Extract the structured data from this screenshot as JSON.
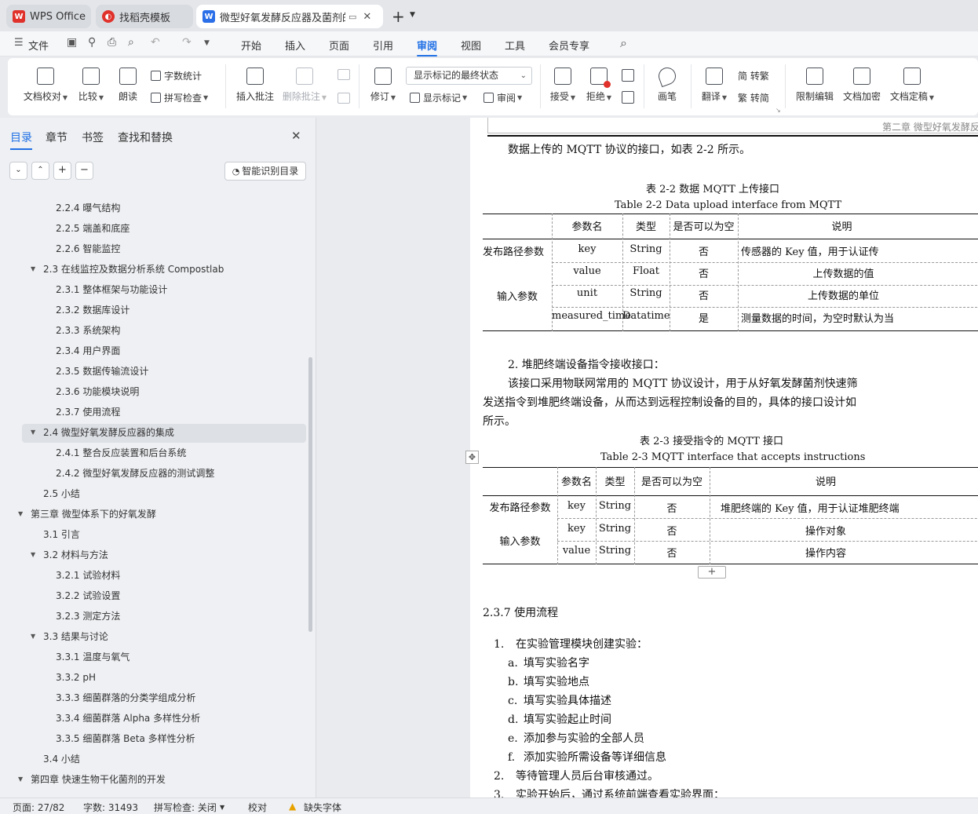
{
  "tabs": [
    {
      "label": "WPS Office"
    },
    {
      "label": "找稻壳模板"
    },
    {
      "label": "微型好氧发酵反应器及菌剂的"
    }
  ],
  "menu": {
    "file": "文件",
    "items": [
      "开始",
      "插入",
      "页面",
      "引用",
      "审阅",
      "视图",
      "工具",
      "会员专享"
    ],
    "active": "审阅"
  },
  "ribbon": {
    "doc_proof": "文档校对",
    "compare": "比较",
    "read_aloud": "朗读",
    "word_count": "字数统计",
    "spell_check": "拼写检查",
    "insert_comment": "插入批注",
    "delete_comment": "删除批注",
    "revise": "修订",
    "markup_state": "显示标记的最终状态",
    "show_markup": "显示标记",
    "review": "审阅",
    "accept": "接受",
    "reject": "拒绝",
    "ink": "画笔",
    "translate": "翻译",
    "to_traditional": "简 转繁",
    "to_simplified": "繁 转简",
    "restrict": "限制编辑",
    "encrypt": "文档加密",
    "finalize": "文档定稿"
  },
  "sidebar": {
    "tabs": [
      "目录",
      "章节",
      "书签",
      "查找和替换"
    ],
    "smart_button": "智能识别目录",
    "toc": [
      {
        "text": "2.2.4 曝气结构",
        "level": 3
      },
      {
        "text": "2.2.5 端盖和底座",
        "level": 3
      },
      {
        "text": "2.2.6 智能监控",
        "level": 3
      },
      {
        "text": "2.3 在线监控及数据分析系统 Compostlab",
        "level": 2,
        "expanded": true
      },
      {
        "text": "2.3.1 整体框架与功能设计",
        "level": 3
      },
      {
        "text": "2.3.2 数据库设计",
        "level": 3
      },
      {
        "text": "2.3.3 系统架构",
        "level": 3
      },
      {
        "text": "2.3.4 用户界面",
        "level": 3
      },
      {
        "text": "2.3.5 数据传输流设计",
        "level": 3
      },
      {
        "text": "2.3.6 功能模块说明",
        "level": 3
      },
      {
        "text": "2.3.7 使用流程",
        "level": 3
      },
      {
        "text": "2.4 微型好氧发酵反应器的集成",
        "level": 2,
        "expanded": true,
        "selected": true
      },
      {
        "text": "2.4.1 整合反应装置和后台系统",
        "level": 3
      },
      {
        "text": "2.4.2 微型好氧发酵反应器的测试调整",
        "level": 3
      },
      {
        "text": "2.5 小结",
        "level": 2
      },
      {
        "text": "第三章  微型体系下的好氧发酵",
        "level": 1,
        "expanded": true
      },
      {
        "text": "3.1 引言",
        "level": 2
      },
      {
        "text": "3.2 材料与方法",
        "level": 2,
        "expanded": true
      },
      {
        "text": "3.2.1 试验材料",
        "level": 3
      },
      {
        "text": "3.2.2 试验设置",
        "level": 3
      },
      {
        "text": "3.2.3 测定方法",
        "level": 3
      },
      {
        "text": "3.3 结果与讨论",
        "level": 2,
        "expanded": true
      },
      {
        "text": "3.3.1 温度与氧气",
        "level": 3
      },
      {
        "text": "3.3.2 pH",
        "level": 3
      },
      {
        "text": "3.3.3 细菌群落的分类学组成分析",
        "level": 3
      },
      {
        "text": "3.3.4 细菌群落 Alpha 多样性分析",
        "level": 3
      },
      {
        "text": "3.3.5 细菌群落 Beta 多样性分析",
        "level": 3
      },
      {
        "text": "3.4 小结",
        "level": 2
      },
      {
        "text": "第四章  快速生物干化菌剂的开发",
        "level": 1,
        "expanded": true
      }
    ]
  },
  "doc": {
    "header_text": "第二章  微型好氧发酵反",
    "para_intro": "数据上传的 MQTT 协议的接口，如表 2-2 所示。",
    "table1": {
      "caption_cn": "表 2-2 数据 MQTT 上传接口",
      "caption_en": "Table 2-2 Data upload interface from MQTT",
      "headers": [
        "参数名",
        "类型",
        "是否可以为空",
        "说明"
      ],
      "group1": "发布路径参数",
      "group2": "输入参数",
      "rows": [
        [
          "key",
          "String",
          "否",
          "传感器的 Key 值，用于认证传"
        ],
        [
          "value",
          "Float",
          "否",
          "上传数据的值"
        ],
        [
          "unit",
          "String",
          "否",
          "上传数据的单位"
        ],
        [
          "measured_time",
          "Datatime",
          "是",
          "测量数据的时间，为空时默认为当"
        ]
      ]
    },
    "item2": "2.  堆肥终端设备指令接收接口：",
    "para2_line1": "该接口采用物联网常用的 MQTT 协议设计，用于从好氧发酵菌剂快速筛",
    "para2_line2": "发送指令到堆肥终端设备，从而达到远程控制设备的目的，具体的接口设计如",
    "para2_line3": "所示。",
    "table2": {
      "caption_cn": "表 2-3 接受指令的 MQTT 接口",
      "caption_en": "Table 2-3 MQTT interface that accepts instructions",
      "headers": [
        "参数名",
        "类型",
        "是否可以为空",
        "说明"
      ],
      "group1": "发布路径参数",
      "group2": "输入参数",
      "rows": [
        [
          "key",
          "String",
          "否",
          "堆肥终端的 Key 值，用于认证堆肥终端"
        ],
        [
          "key",
          "String",
          "否",
          "操作对象"
        ],
        [
          "value",
          "String",
          "否",
          "操作内容"
        ]
      ]
    },
    "section_title": "2.3.7 使用流程",
    "steps": [
      {
        "n": "1.",
        "t": "在实验管理模块创建实验："
      },
      {
        "n": "a.",
        "t": "填写实验名字"
      },
      {
        "n": "b.",
        "t": "填写实验地点"
      },
      {
        "n": "c.",
        "t": "填写实验具体描述"
      },
      {
        "n": "d.",
        "t": "填写实验起止时间"
      },
      {
        "n": "e.",
        "t": "添加参与实验的全部人员"
      },
      {
        "n": "f.",
        "t": "添加实验所需设备等详细信息"
      },
      {
        "n": "2.",
        "t": "等待管理人员后台审核通过。"
      },
      {
        "n": "3.",
        "t": "实验开始后，通过系统前端查看实验界面："
      }
    ]
  },
  "status": {
    "page": "页面: 27/82",
    "words": "字数: 31493",
    "spell": "拼写检查: 关闭",
    "proof": "校对",
    "font_warn": "缺失字体"
  },
  "colors": {
    "accent": "#1f6fe5",
    "wps_red": "#e0312b",
    "writer_blue": "#2a6ee8"
  }
}
